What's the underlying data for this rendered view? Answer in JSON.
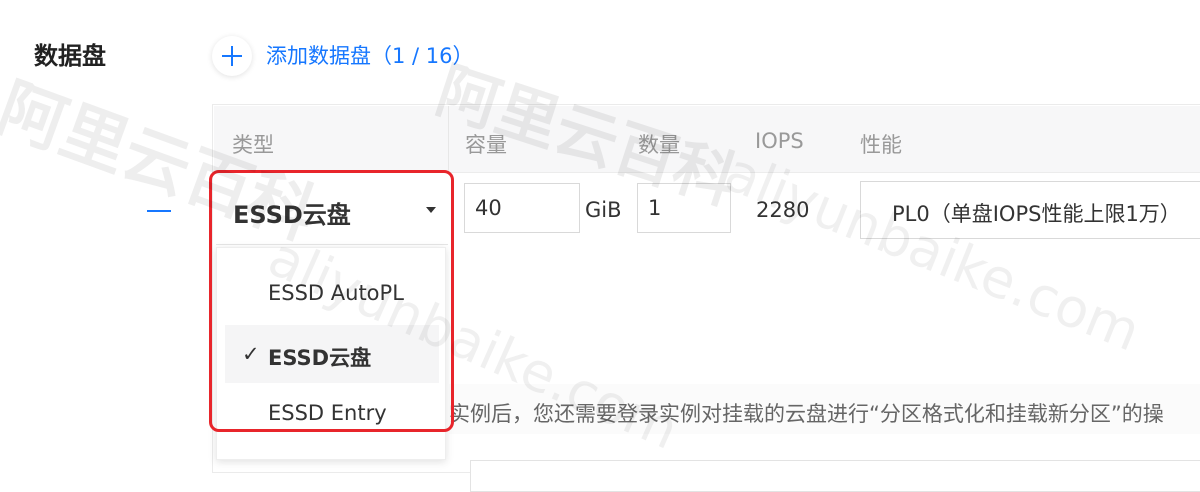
{
  "section_label": "数据盘",
  "add_link": "添加数据盘（1 / 16）",
  "table": {
    "headers": {
      "type": "类型",
      "capacity": "容量",
      "quantity": "数量",
      "iops": "IOPS",
      "performance": "性能"
    },
    "row": {
      "type_value": "ESSD云盘",
      "capacity_value": "40",
      "capacity_unit": "GiB",
      "quantity_value": "1",
      "iops_value": "2280",
      "performance_value": "PL0（单盘IOPS性能上限1万）"
    }
  },
  "dropdown": {
    "options": [
      {
        "label": "ESSD AutoPL",
        "selected": false
      },
      {
        "label": "ESSD云盘",
        "selected": true
      },
      {
        "label": "ESSD Entry",
        "selected": false
      }
    ],
    "check_mark": "✓"
  },
  "hint": "实例后，您还需要登录实例对挂载的云盘进行“分区格式化和挂载新分区”的操",
  "watermarks": {
    "brand": "阿里云百科",
    "url": "aliyunbaike.com"
  },
  "colors": {
    "accent": "#1677ff",
    "highlight": "#e8252b"
  }
}
